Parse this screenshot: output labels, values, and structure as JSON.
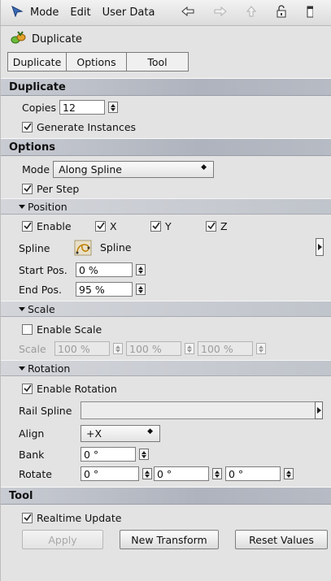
{
  "menubar": {
    "mode": "Mode",
    "edit": "Edit",
    "user_data": "User Data"
  },
  "object": {
    "name": "Duplicate"
  },
  "tabs": [
    "Duplicate",
    "Options",
    "Tool"
  ],
  "sections": {
    "duplicate": "Duplicate",
    "options": "Options",
    "tool": "Tool"
  },
  "duplicate": {
    "copies_label": "Copies",
    "copies_value": "12",
    "generate_instances": "Generate Instances"
  },
  "options": {
    "mode_label": "Mode",
    "mode_value": "Along Spline",
    "per_step": "Per Step",
    "position": {
      "title": "Position",
      "enable": "Enable",
      "x": "X",
      "y": "Y",
      "z": "Z",
      "spline_label": "Spline",
      "spline_value": "Spline",
      "start_label": "Start Pos.",
      "start_value": "0 %",
      "end_label": "End Pos.",
      "end_value": "95 %"
    },
    "scale": {
      "title": "Scale",
      "enable": "Enable Scale",
      "label": "Scale",
      "v1": "100 %",
      "v2": "100 %",
      "v3": "100 %"
    },
    "rotation": {
      "title": "Rotation",
      "enable": "Enable Rotation",
      "rail_label": "Rail Spline",
      "align_label": "Align",
      "align_value": "+X",
      "bank_label": "Bank",
      "bank_value": "0 °",
      "rotate_label": "Rotate",
      "r1": "0 °",
      "r2": "0 °",
      "r3": "0 °"
    }
  },
  "tool": {
    "realtime": "Realtime Update",
    "apply": "Apply",
    "new_transform": "New Transform",
    "reset_values": "Reset Values"
  }
}
